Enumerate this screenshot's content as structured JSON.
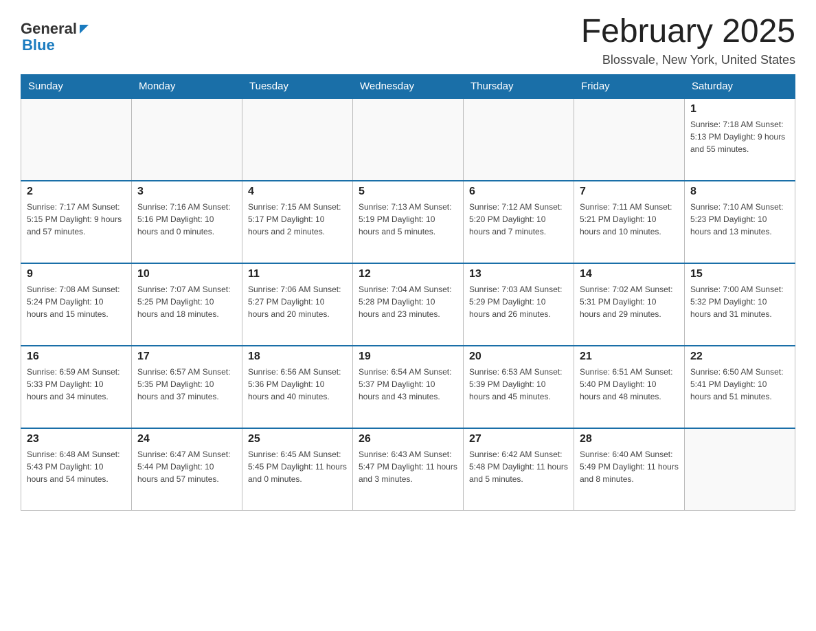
{
  "header": {
    "logo": {
      "general": "General",
      "blue": "Blue"
    },
    "title": "February 2025",
    "location": "Blossvale, New York, United States"
  },
  "weekdays": [
    "Sunday",
    "Monday",
    "Tuesday",
    "Wednesday",
    "Thursday",
    "Friday",
    "Saturday"
  ],
  "weeks": [
    [
      {
        "day": "",
        "info": ""
      },
      {
        "day": "",
        "info": ""
      },
      {
        "day": "",
        "info": ""
      },
      {
        "day": "",
        "info": ""
      },
      {
        "day": "",
        "info": ""
      },
      {
        "day": "",
        "info": ""
      },
      {
        "day": "1",
        "info": "Sunrise: 7:18 AM\nSunset: 5:13 PM\nDaylight: 9 hours and 55 minutes."
      }
    ],
    [
      {
        "day": "2",
        "info": "Sunrise: 7:17 AM\nSunset: 5:15 PM\nDaylight: 9 hours and 57 minutes."
      },
      {
        "day": "3",
        "info": "Sunrise: 7:16 AM\nSunset: 5:16 PM\nDaylight: 10 hours and 0 minutes."
      },
      {
        "day": "4",
        "info": "Sunrise: 7:15 AM\nSunset: 5:17 PM\nDaylight: 10 hours and 2 minutes."
      },
      {
        "day": "5",
        "info": "Sunrise: 7:13 AM\nSunset: 5:19 PM\nDaylight: 10 hours and 5 minutes."
      },
      {
        "day": "6",
        "info": "Sunrise: 7:12 AM\nSunset: 5:20 PM\nDaylight: 10 hours and 7 minutes."
      },
      {
        "day": "7",
        "info": "Sunrise: 7:11 AM\nSunset: 5:21 PM\nDaylight: 10 hours and 10 minutes."
      },
      {
        "day": "8",
        "info": "Sunrise: 7:10 AM\nSunset: 5:23 PM\nDaylight: 10 hours and 13 minutes."
      }
    ],
    [
      {
        "day": "9",
        "info": "Sunrise: 7:08 AM\nSunset: 5:24 PM\nDaylight: 10 hours and 15 minutes."
      },
      {
        "day": "10",
        "info": "Sunrise: 7:07 AM\nSunset: 5:25 PM\nDaylight: 10 hours and 18 minutes."
      },
      {
        "day": "11",
        "info": "Sunrise: 7:06 AM\nSunset: 5:27 PM\nDaylight: 10 hours and 20 minutes."
      },
      {
        "day": "12",
        "info": "Sunrise: 7:04 AM\nSunset: 5:28 PM\nDaylight: 10 hours and 23 minutes."
      },
      {
        "day": "13",
        "info": "Sunrise: 7:03 AM\nSunset: 5:29 PM\nDaylight: 10 hours and 26 minutes."
      },
      {
        "day": "14",
        "info": "Sunrise: 7:02 AM\nSunset: 5:31 PM\nDaylight: 10 hours and 29 minutes."
      },
      {
        "day": "15",
        "info": "Sunrise: 7:00 AM\nSunset: 5:32 PM\nDaylight: 10 hours and 31 minutes."
      }
    ],
    [
      {
        "day": "16",
        "info": "Sunrise: 6:59 AM\nSunset: 5:33 PM\nDaylight: 10 hours and 34 minutes."
      },
      {
        "day": "17",
        "info": "Sunrise: 6:57 AM\nSunset: 5:35 PM\nDaylight: 10 hours and 37 minutes."
      },
      {
        "day": "18",
        "info": "Sunrise: 6:56 AM\nSunset: 5:36 PM\nDaylight: 10 hours and 40 minutes."
      },
      {
        "day": "19",
        "info": "Sunrise: 6:54 AM\nSunset: 5:37 PM\nDaylight: 10 hours and 43 minutes."
      },
      {
        "day": "20",
        "info": "Sunrise: 6:53 AM\nSunset: 5:39 PM\nDaylight: 10 hours and 45 minutes."
      },
      {
        "day": "21",
        "info": "Sunrise: 6:51 AM\nSunset: 5:40 PM\nDaylight: 10 hours and 48 minutes."
      },
      {
        "day": "22",
        "info": "Sunrise: 6:50 AM\nSunset: 5:41 PM\nDaylight: 10 hours and 51 minutes."
      }
    ],
    [
      {
        "day": "23",
        "info": "Sunrise: 6:48 AM\nSunset: 5:43 PM\nDaylight: 10 hours and 54 minutes."
      },
      {
        "day": "24",
        "info": "Sunrise: 6:47 AM\nSunset: 5:44 PM\nDaylight: 10 hours and 57 minutes."
      },
      {
        "day": "25",
        "info": "Sunrise: 6:45 AM\nSunset: 5:45 PM\nDaylight: 11 hours and 0 minutes."
      },
      {
        "day": "26",
        "info": "Sunrise: 6:43 AM\nSunset: 5:47 PM\nDaylight: 11 hours and 3 minutes."
      },
      {
        "day": "27",
        "info": "Sunrise: 6:42 AM\nSunset: 5:48 PM\nDaylight: 11 hours and 5 minutes."
      },
      {
        "day": "28",
        "info": "Sunrise: 6:40 AM\nSunset: 5:49 PM\nDaylight: 11 hours and 8 minutes."
      },
      {
        "day": "",
        "info": ""
      }
    ]
  ]
}
